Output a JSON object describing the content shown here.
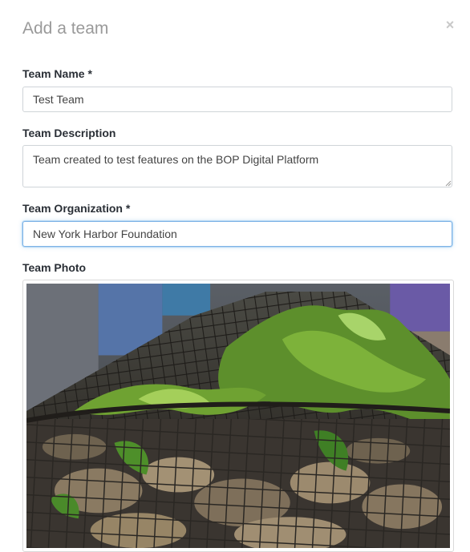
{
  "modal": {
    "title": "Add a team",
    "close_symbol": "×"
  },
  "form": {
    "name": {
      "label": "Team Name *",
      "value": "Test Team"
    },
    "description": {
      "label": "Team Description",
      "value": "Team created to test features on the BOP Digital Platform"
    },
    "organization": {
      "label": "Team Organization *",
      "value": "New York Harbor Foundation"
    },
    "photo": {
      "label": "Team Photo"
    }
  },
  "icons": {
    "close": "close-icon",
    "resize": "resize-grip-icon"
  },
  "colors": {
    "label_text": "#2a2f36",
    "title_text": "#9a9a9a",
    "focus_border": "#7fb3e6",
    "field_border": "#cfd4d8"
  }
}
